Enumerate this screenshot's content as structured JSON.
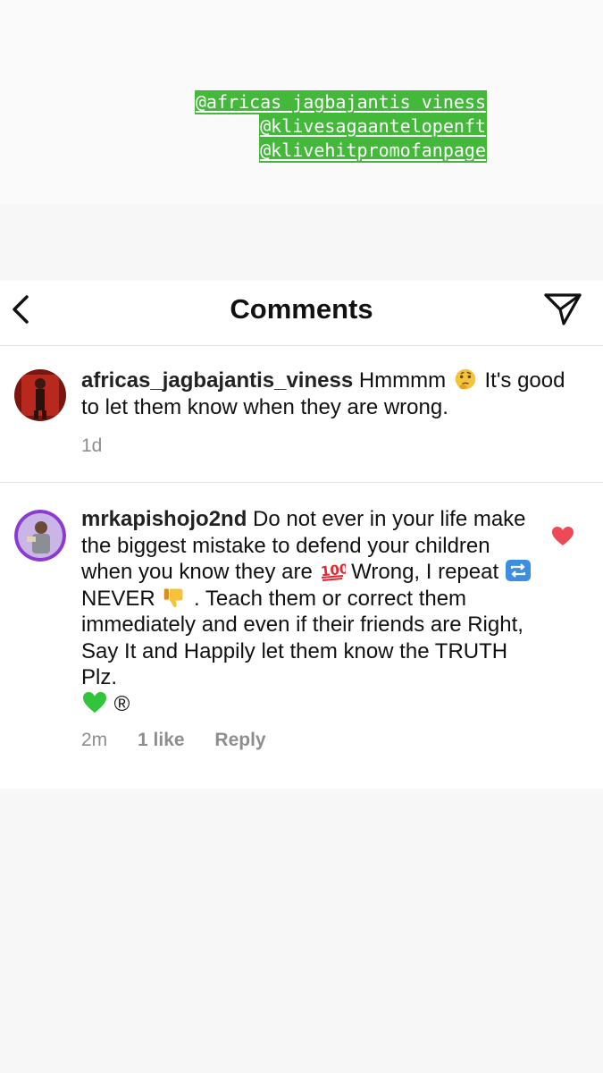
{
  "story": {
    "tags": [
      "@africas_jagbajantis_viness",
      "@klivesagaantelopenft",
      "@klivehitpromofanpage"
    ],
    "tag_color": "#44b83a"
  },
  "header": {
    "title": "Comments",
    "back_icon": "chevron-left-icon",
    "share_icon": "send-icon"
  },
  "comments": [
    {
      "user": "africas_jagbajantis_viness",
      "text_1": " Hmmmm ",
      "text_2": " It's good to let them know when they are wrong.",
      "emoji_1": "thinking-face-icon",
      "time": "1d"
    },
    {
      "user": "mrkapishojo2nd",
      "text_1": " Do not ever in your life make the biggest mistake to defend your children when you know they are ",
      "text_2": " Wrong, I repeat ",
      "text_3": " NEVER ",
      "text_4": " . Teach them or correct them immediately and even if their friends are Right, Say It and Happily let them know the TRUTH Plz.",
      "text_5": "®",
      "time": "2m",
      "likes": "1 like",
      "reply": "Reply",
      "liked": true,
      "heart_color": "#ed4956"
    }
  ]
}
